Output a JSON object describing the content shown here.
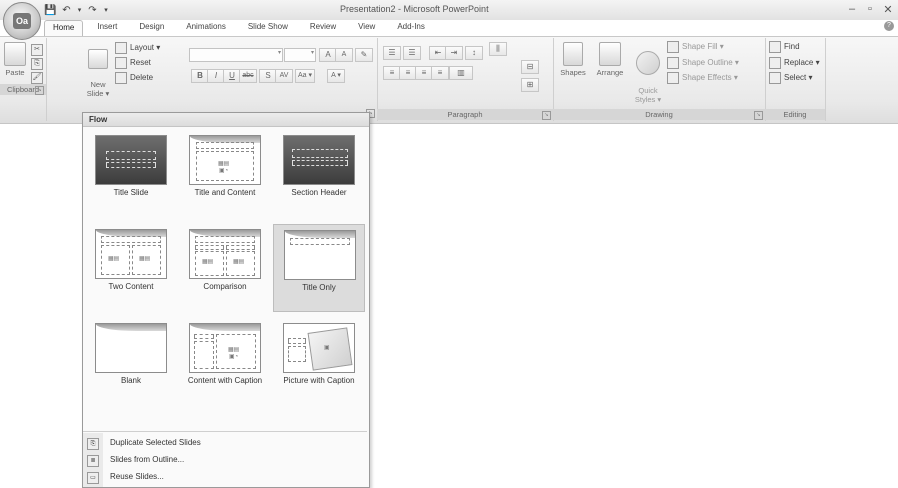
{
  "window": {
    "title": "Presentation2 - Microsoft PowerPoint",
    "minimize": "–",
    "restore": "▫",
    "close": "✕"
  },
  "office_button": {
    "logo": "Oa"
  },
  "qat": {
    "save": "💾",
    "undo": "↶",
    "undo_arrow": "▾",
    "redo": "↷",
    "customize": "▾"
  },
  "tabs": [
    "Home",
    "Insert",
    "Design",
    "Animations",
    "Slide Show",
    "Review",
    "View",
    "Add-Ins"
  ],
  "help": "?",
  "ribbon": {
    "clipboard": {
      "label": "Clipboard",
      "paste": "Paste",
      "cut": "✂",
      "copy": "⎘",
      "format_painter": "🖌"
    },
    "slides": {
      "new_slide": "New\nSlide ▾",
      "layout": "Layout ▾",
      "reset": "Reset",
      "delete": "Delete"
    },
    "font": {
      "grow": "A",
      "shrink": "A",
      "clear": "✎",
      "bold": "B",
      "italic": "I",
      "underline": "U",
      "strike": "abc",
      "shadow": "S",
      "spacing": "AV",
      "case": "Aa ▾",
      "color": "A ▾"
    },
    "paragraph": {
      "label": "Paragraph"
    },
    "drawing": {
      "label": "Drawing",
      "shapes": "Shapes",
      "arrange": "Arrange",
      "quick_styles": "Quick\nStyles ▾",
      "shape_fill": "Shape Fill ▾",
      "shape_outline": "Shape Outline ▾",
      "shape_effects": "Shape Effects ▾"
    },
    "editing": {
      "label": "Editing",
      "find": "Find",
      "replace": "Replace ▾",
      "select": "Select ▾"
    }
  },
  "dropdown": {
    "header": "Flow",
    "layouts": [
      "Title Slide",
      "Title and Content",
      "Section Header",
      "Two Content",
      "Comparison",
      "Title Only",
      "Blank",
      "Content with Caption",
      "Picture with Caption"
    ],
    "selected_layout": "Title Only",
    "menu": [
      "Duplicate Selected Slides",
      "Slides from Outline...",
      "Reuse Slides..."
    ]
  }
}
